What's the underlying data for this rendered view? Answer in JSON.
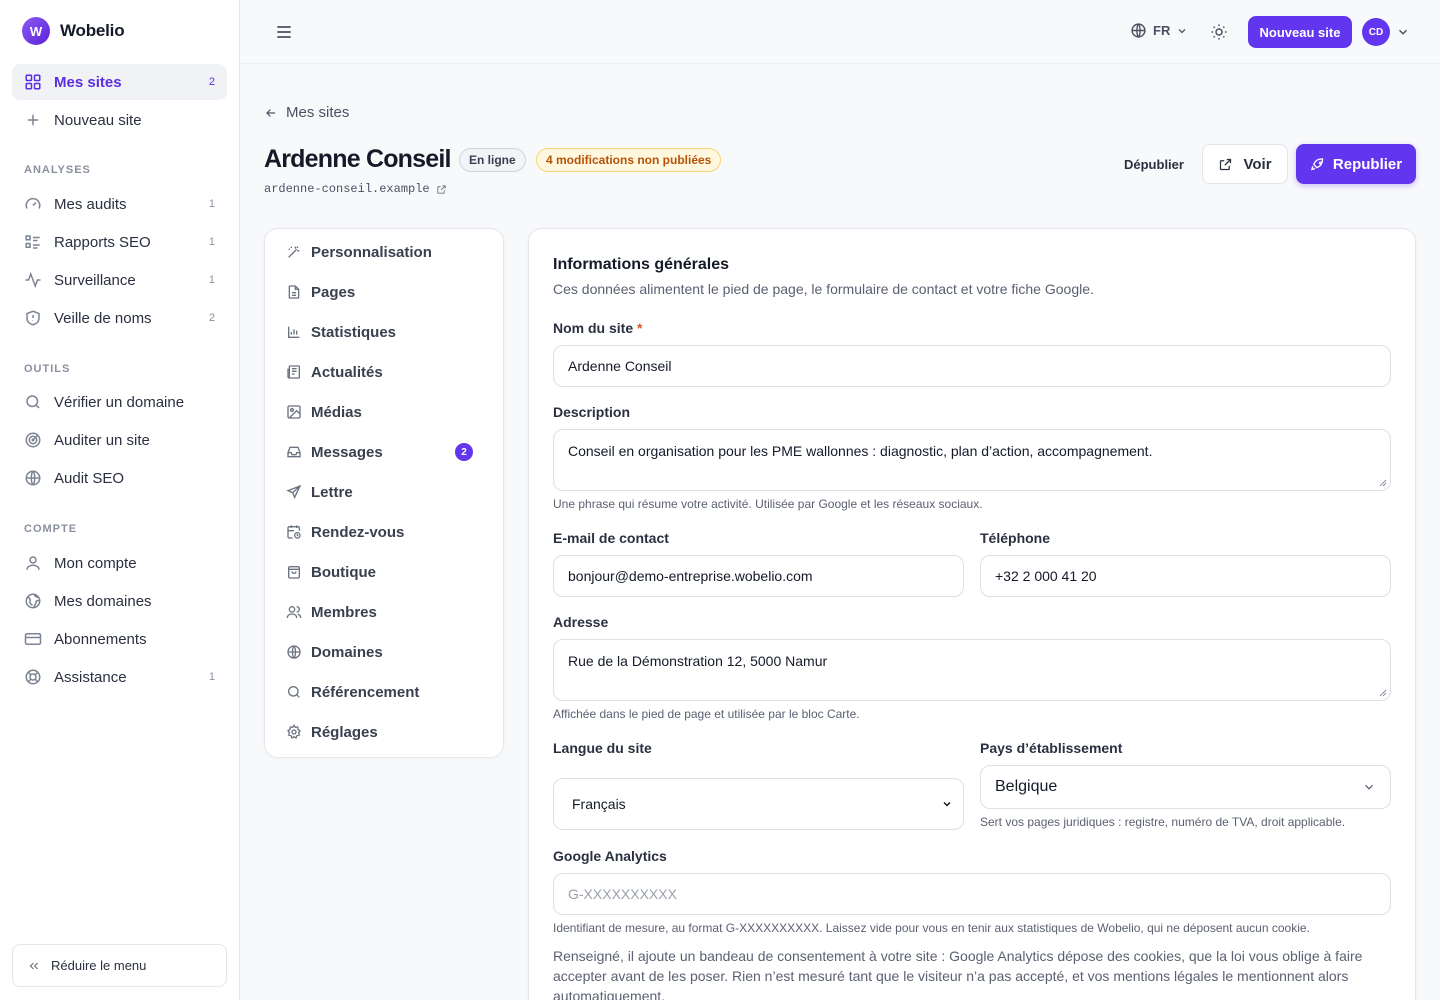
{
  "brand": {
    "name": "Wobelio",
    "logo_letter": "W"
  },
  "sidebar": {
    "main": [
      {
        "label": "Mes sites",
        "count": "2",
        "icon": "grid-icon",
        "active": true
      },
      {
        "label": "Nouveau site",
        "count": "",
        "icon": "plus-icon"
      }
    ],
    "sections": {
      "analyses": "ANALYSES",
      "outils": "OUTILS",
      "compte": "COMPTE"
    },
    "analyses": [
      {
        "label": "Mes audits",
        "count": "1",
        "icon": "gauge-icon"
      },
      {
        "label": "Rapports SEO",
        "count": "1",
        "icon": "list-icon"
      },
      {
        "label": "Surveillance",
        "count": "1",
        "icon": "activity-icon"
      },
      {
        "label": "Veille de noms",
        "count": "2",
        "icon": "shield-icon"
      }
    ],
    "outils": [
      {
        "label": "Vérifier un domaine",
        "icon": "search-icon"
      },
      {
        "label": "Auditer un site",
        "icon": "radar-icon"
      },
      {
        "label": "Audit SEO",
        "icon": "globe-icon"
      }
    ],
    "compte": [
      {
        "label": "Mon compte",
        "icon": "user-icon"
      },
      {
        "label": "Mes domaines",
        "icon": "globe-icon"
      },
      {
        "label": "Abonnements",
        "icon": "credit-card-icon"
      },
      {
        "label": "Assistance",
        "count": "1",
        "icon": "lifebuoy-icon"
      }
    ],
    "collapse_label": "Réduire le menu"
  },
  "topbar": {
    "language": "FR",
    "new_site_label": "Nouveau site",
    "avatar_initials": "CD"
  },
  "header": {
    "back_label": "Mes sites",
    "site_name": "Ardenne Conseil",
    "status_badge": "En ligne",
    "changes_badge": "4 modifications non publiées",
    "domain": "ardenne-conseil.example",
    "unpublish_label": "Dépublier",
    "view_label": "Voir",
    "republish_label": "Republier"
  },
  "subnav": [
    {
      "label": "Personnalisation",
      "icon": "wand-icon"
    },
    {
      "label": "Pages",
      "icon": "file-icon"
    },
    {
      "label": "Statistiques",
      "icon": "bar-chart-icon"
    },
    {
      "label": "Actualités",
      "icon": "newspaper-icon"
    },
    {
      "label": "Médias",
      "icon": "image-icon"
    },
    {
      "label": "Messages",
      "icon": "inbox-icon",
      "badge": "2"
    },
    {
      "label": "Lettre",
      "icon": "send-icon"
    },
    {
      "label": "Rendez-vous",
      "icon": "calendar-clock-icon"
    },
    {
      "label": "Boutique",
      "icon": "shopping-bag-icon"
    },
    {
      "label": "Membres",
      "icon": "users-icon"
    },
    {
      "label": "Domaines",
      "icon": "globe-icon"
    },
    {
      "label": "Référencement",
      "icon": "search-icon"
    },
    {
      "label": "Réglages",
      "icon": "gear-icon"
    }
  ],
  "form": {
    "title": "Informations générales",
    "subtitle": "Ces données alimentent le pied de page, le formulaire de contact et votre fiche Google.",
    "site_name": {
      "label": "Nom du site",
      "required_mark": "*",
      "value": "Ardenne Conseil"
    },
    "description": {
      "label": "Description",
      "value": "Conseil en organisation pour les PME wallonnes : diagnostic, plan d’action, accompagnement.",
      "help": "Une phrase qui résume votre activité. Utilisée par Google et les réseaux sociaux."
    },
    "email": {
      "label": "E-mail de contact",
      "value": "bonjour@demo-entreprise.wobelio.com"
    },
    "phone": {
      "label": "Téléphone",
      "value": "+32 2 000 41 20"
    },
    "address": {
      "label": "Adresse",
      "value": "Rue de la Démonstration 12, 5000 Namur",
      "help": "Affichée dans le pied de page et utilisée par le bloc Carte."
    },
    "language": {
      "label": "Langue du site",
      "value": "Français"
    },
    "country": {
      "label": "Pays d’établissement",
      "value": "Belgique",
      "help": "Sert vos pages juridiques : registre, numéro de TVA, droit applicable."
    },
    "analytics": {
      "label": "Google Analytics",
      "placeholder": "G-XXXXXXXXXX",
      "help": "Identifiant de mesure, au format G-XXXXXXXXXX. Laissez vide pour vous en tenir aux statistiques de Wobelio, qui ne déposent aucun cookie.",
      "note": "Renseigné, il ajoute un bandeau de consentement à votre site : Google Analytics dépose des cookies, que la loi vous oblige à faire accepter avant de les poser. Rien n’est mesuré tant que le visiteur n’a pas accepté, et vos mentions légales le mentionnent alors automatiquement."
    }
  },
  "colors": {
    "accent": "#6236ef",
    "warning_text": "#b45309",
    "warning_bg": "#fff8de",
    "required": "#e0562b"
  }
}
